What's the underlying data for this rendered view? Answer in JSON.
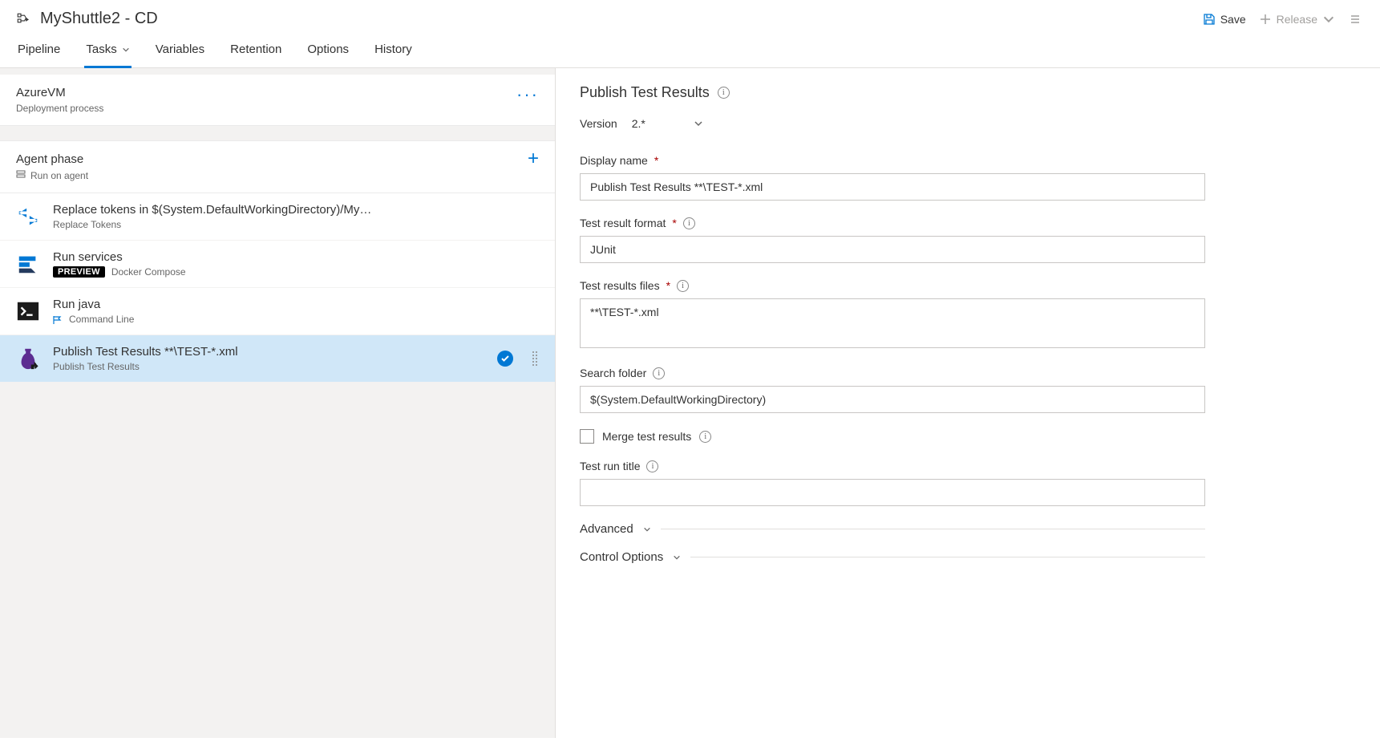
{
  "header": {
    "title": "MyShuttle2 - CD",
    "save_label": "Save",
    "release_label": "Release"
  },
  "tabs": {
    "pipeline": "Pipeline",
    "tasks": "Tasks",
    "variables": "Variables",
    "retention": "Retention",
    "options": "Options",
    "history": "History"
  },
  "env": {
    "name": "AzureVM",
    "sub": "Deployment process"
  },
  "phase": {
    "name": "Agent phase",
    "sub": "Run on agent"
  },
  "tasks_list": {
    "replace": {
      "title": "Replace tokens in $(System.DefaultWorkingDirectory)/My…",
      "sub": "Replace Tokens"
    },
    "run_services": {
      "title": "Run services",
      "sub_name": "Docker Compose",
      "preview": "PREVIEW"
    },
    "run_java": {
      "title": "Run java",
      "sub": "Command Line"
    },
    "publish": {
      "title": "Publish Test Results **\\TEST-*.xml",
      "sub": "Publish Test Results"
    }
  },
  "form": {
    "heading": "Publish Test Results",
    "version_label": "Version",
    "version_value": "2.*",
    "display_name_label": "Display name",
    "display_name_value": "Publish Test Results **\\TEST-*.xml",
    "test_format_label": "Test result format",
    "test_format_value": "JUnit",
    "test_files_label": "Test results files",
    "test_files_value": "**\\TEST-*.xml",
    "search_folder_label": "Search folder",
    "search_folder_value": "$(System.DefaultWorkingDirectory)",
    "merge_label": "Merge test results",
    "run_title_label": "Test run title",
    "run_title_value": "",
    "advanced": "Advanced",
    "control_options": "Control Options"
  }
}
